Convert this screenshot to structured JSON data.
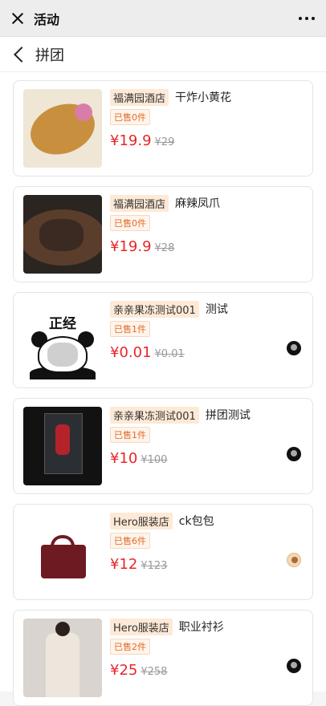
{
  "topbar": {
    "title": "活动"
  },
  "navbar": {
    "title": "拼团"
  },
  "products": [
    {
      "shop": "福满园酒店",
      "name": "干炸小黄花",
      "sold": "已售0件",
      "price": "¥19.9",
      "old_price": "¥29",
      "thumb": "fried-fish"
    },
    {
      "shop": "福满园酒店",
      "name": "麻辣凤爪",
      "sold": "已售0件",
      "price": "¥19.9",
      "old_price": "¥28",
      "thumb": "chicken-feet"
    },
    {
      "shop": "亲亲果冻测试001",
      "name": "测试",
      "sold": "已售1件",
      "price": "¥0.01",
      "old_price": "¥0.01",
      "thumb_text": "正经",
      "avatar": "dark"
    },
    {
      "shop": "亲亲果冻测试001",
      "name": "拼团测试",
      "sold": "已售1件",
      "price": "¥10",
      "old_price": "¥100",
      "thumb": "figure-display",
      "avatar": "dark"
    },
    {
      "shop": "Hero服装店",
      "name": "ck包包",
      "sold": "已售6件",
      "price": "¥12",
      "old_price": "¥123",
      "thumb": "red-handbag",
      "avatar": "orange"
    },
    {
      "shop": "Hero服装店",
      "name": "职业衬衫",
      "sold": "已售2件",
      "price": "¥25",
      "old_price": "¥258",
      "thumb": "shirt-model",
      "avatar": "dark"
    }
  ],
  "colors": {
    "price": "#e8262a",
    "shop_tag_bg": "#fde9d6",
    "sold_text": "#e06a2a"
  }
}
